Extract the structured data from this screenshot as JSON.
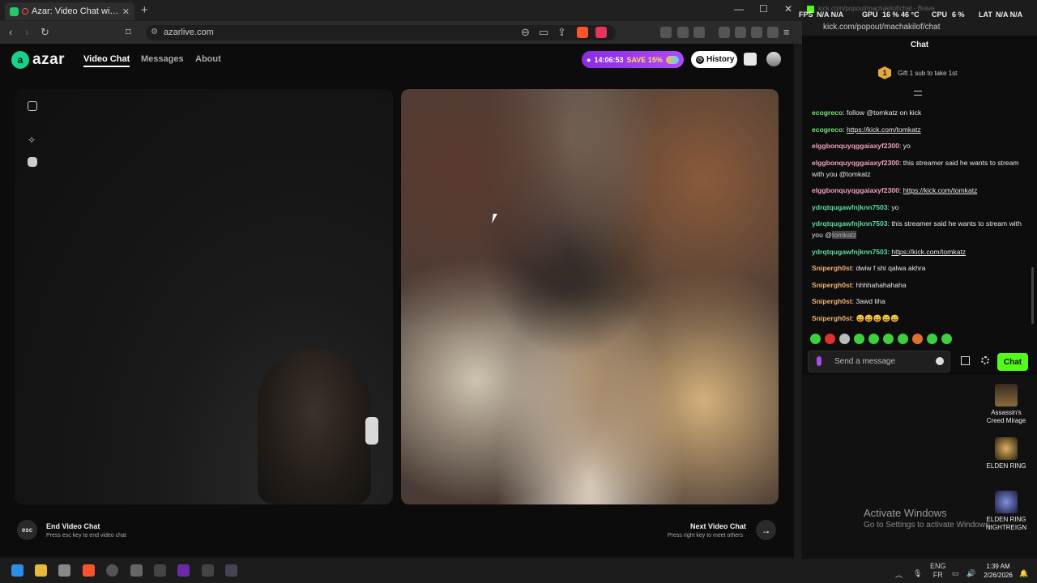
{
  "browser": {
    "tab_title": "Azar: Video Chat with New Pe",
    "url": "azarlive.com"
  },
  "azar": {
    "logo_text": "azar",
    "nav": [
      "Video Chat",
      "Messages",
      "About"
    ],
    "promo_timer": "14:06:53",
    "promo_save": "SAVE 15%",
    "history_label": "History",
    "esc_label": "esc",
    "end_title": "End Video Chat",
    "end_hint": "Press esc key to end video chat",
    "next_title": "Next Video Chat",
    "next_hint": "Press right key to meet others",
    "next_arrow": "→"
  },
  "popout": {
    "faded_title": "kick.com/popout/machakilof/chat - Brave",
    "url": "kick.com/popout/machakilof/chat",
    "chat_title": "Chat",
    "pinned_number": "1",
    "pinned_text": "Gift 1 sub to take 1st",
    "input_placeholder": "Send a message",
    "chat_button": "Chat",
    "messages": [
      {
        "user": "ecogreco",
        "color": "#7fe07f",
        "text": "follow @tomkatz on kick",
        "link": ""
      },
      {
        "user": "ecogreco",
        "color": "#7fe07f",
        "text": "",
        "link": "https://kick.com/tomkatz"
      },
      {
        "user": "elggbonquyqggaiaxyf2300",
        "color": "#f0a0c0",
        "text": "yo",
        "link": ""
      },
      {
        "user": "elggbonquyqggaiaxyf2300",
        "color": "#f0a0c0",
        "text": "this streamer said he wants to stream with you @tomkatz",
        "link": ""
      },
      {
        "user": "elggbonquyqggaiaxyf2300",
        "color": "#f0a0c0",
        "text": "",
        "link": "https://kick.com/tomkatz"
      },
      {
        "user": "ydrqtqugawfnjknn7503",
        "color": "#5ed8a0",
        "text": "yo",
        "link": ""
      },
      {
        "user": "ydrqtqugawfnjknn7503",
        "color": "#5ed8a0",
        "text": "this streamer said he wants to stream with you @",
        "link": "",
        "highlight": "tomkatz"
      },
      {
        "user": "ydrqtqugawfnjknn7503",
        "color": "#5ed8a0",
        "text": "",
        "link": "https://kick.com/tomkatz"
      },
      {
        "user": "Snipergh0st",
        "color": "#f0b070",
        "text": "dwiw f shi qalwa akhra",
        "link": ""
      },
      {
        "user": "Snipergh0st",
        "color": "#f0b070",
        "text": "hhhhahahahaha",
        "link": ""
      },
      {
        "user": "Snipergh0st",
        "color": "#f0b070",
        "text": "3awd liha",
        "link": ""
      },
      {
        "user": "Snipergh0st",
        "color": "#f0b070",
        "text": "😄😄😄😄😄",
        "link": ""
      }
    ]
  },
  "overlay": {
    "fps_label": "FPS",
    "fps_val": "N/A N/A",
    "gpu_label": "GPU",
    "gpu_val": "16 % 46 °C",
    "cpu_label": "CPU",
    "cpu_val": "6 %",
    "lat_label": "LAT",
    "lat_val": "N/A N/A"
  },
  "desktop": {
    "icons": [
      "Assassin's Creed Mirage",
      "ELDEN RING",
      "ELDEN RING NIGHTREIGN"
    ],
    "activate_title": "Activate Windows",
    "activate_sub": "Go to Settings to activate Windows."
  },
  "taskbar": {
    "lang_top": "ENG",
    "lang_bottom": "FR",
    "time": "1:39 AM",
    "date": "2/26/2026"
  }
}
